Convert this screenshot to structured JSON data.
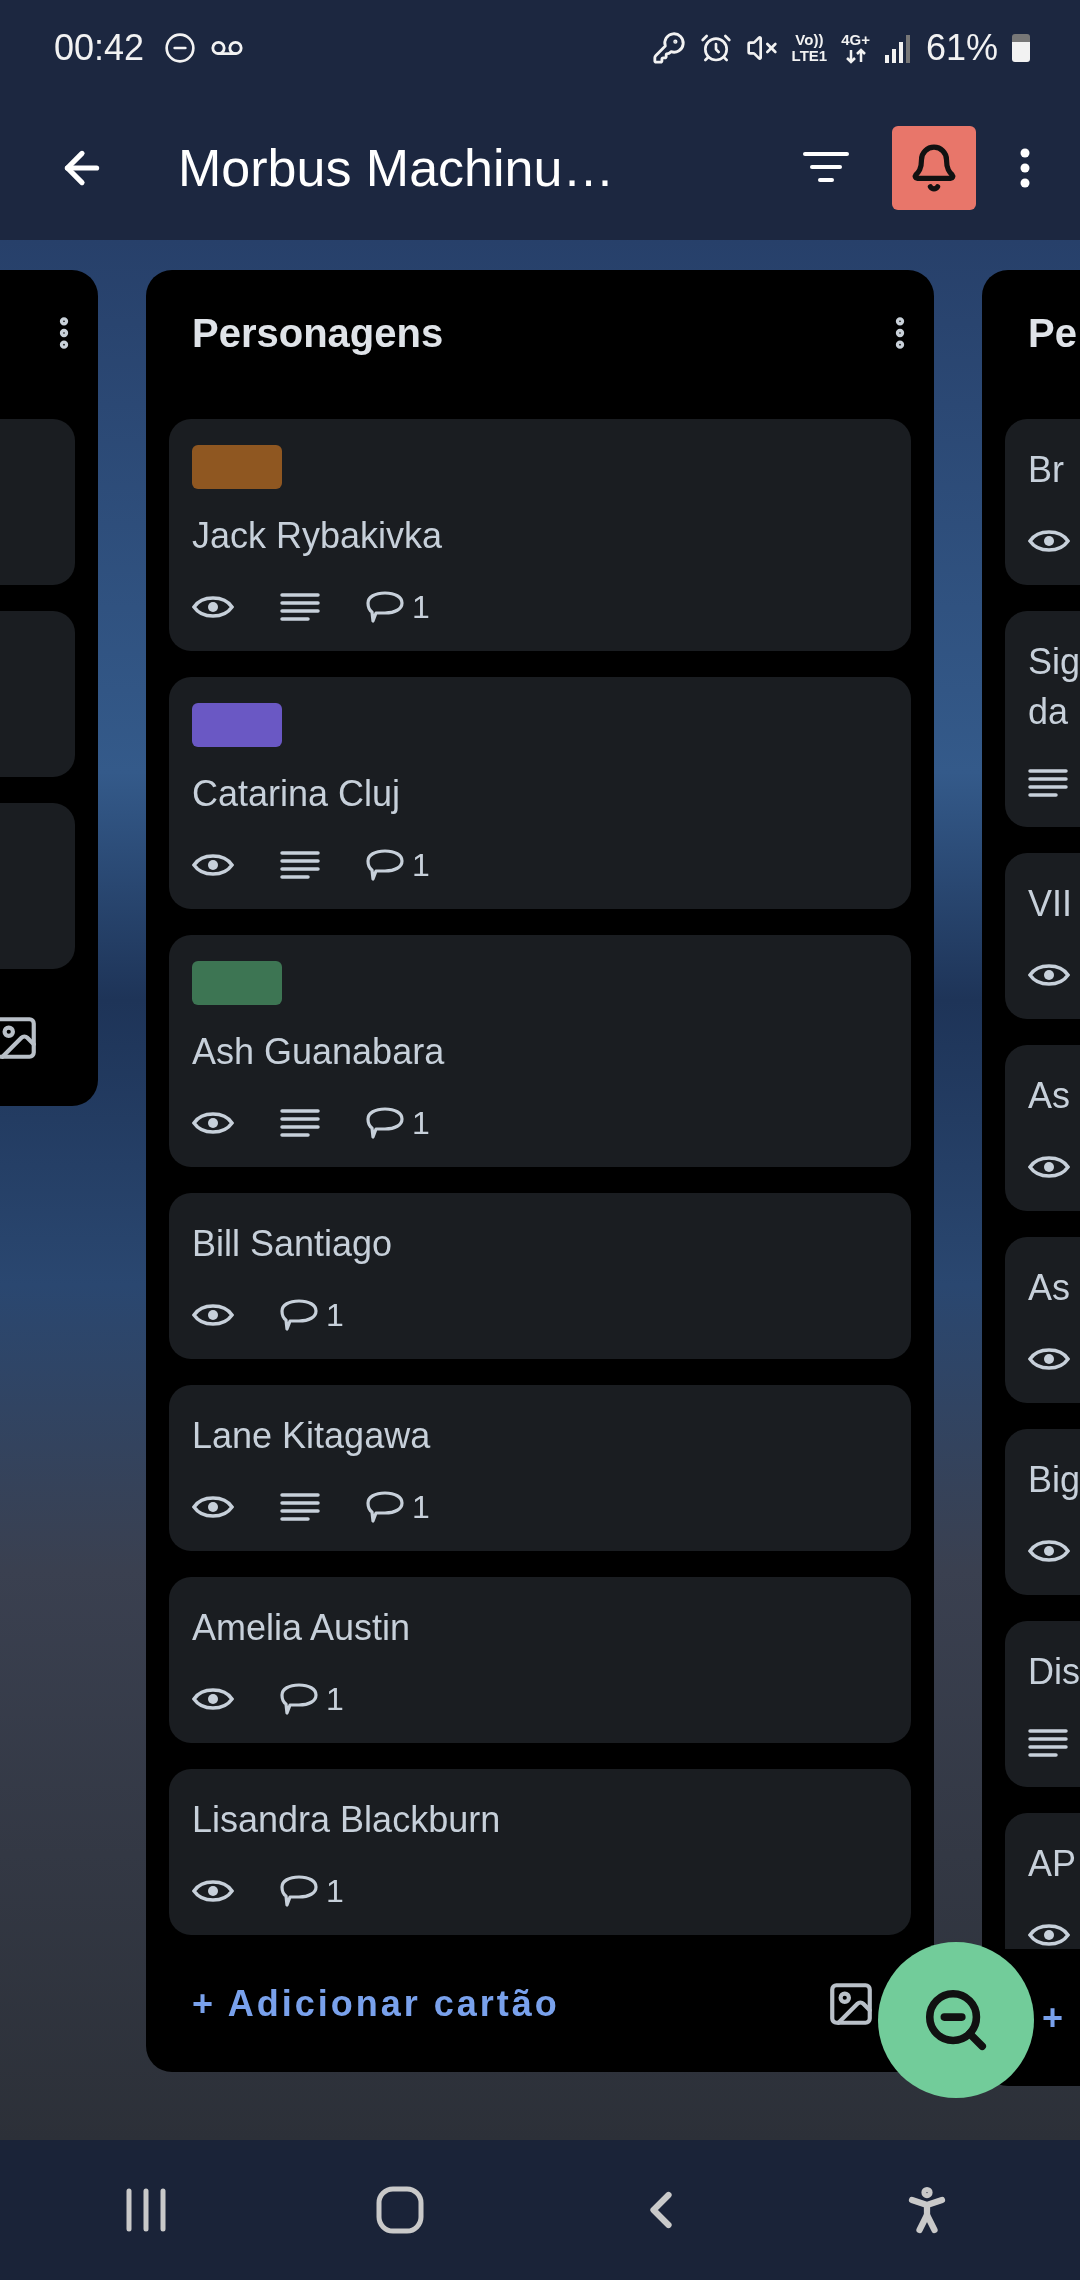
{
  "status_bar": {
    "time": "00:42",
    "volte_top": "Vo))",
    "volte_bottom": "LTE1",
    "network": "4G+",
    "battery": "61%"
  },
  "toolbar": {
    "title": "Morbus Machinu…",
    "notifications_on": true
  },
  "columns": [
    {
      "cards": [
        {
          "kind": "blank"
        },
        {
          "kind": "blank"
        },
        {
          "kind": "blank"
        }
      ]
    },
    {
      "title": "Personagens",
      "add_label": "+ Adicionar cartão",
      "cards": [
        {
          "color": "#8f5721",
          "title": "Jack Rybakivka",
          "watching": true,
          "description": true,
          "comments": "1"
        },
        {
          "color": "#6a58c4",
          "title": "Catarina Cluj",
          "watching": true,
          "description": true,
          "comments": "1"
        },
        {
          "color": "#3d7553",
          "title": "Ash Guanabara",
          "watching": true,
          "description": true,
          "comments": "1"
        },
        {
          "title": "Bill Santiago",
          "watching": true,
          "description": false,
          "comments": "1"
        },
        {
          "title": "Lane Kitagawa",
          "watching": true,
          "description": true,
          "comments": "1"
        },
        {
          "title": "Amelia Austin",
          "watching": true,
          "description": false,
          "comments": "1"
        },
        {
          "title": "Lisandra Blackburn",
          "watching": true,
          "description": false,
          "comments": "1"
        }
      ]
    },
    {
      "title": "Pe",
      "add_label": "+",
      "cards": [
        {
          "title": "Br",
          "watching": true,
          "description": false
        },
        {
          "title": "Sig da",
          "watching": false,
          "description": true
        },
        {
          "title": "VII",
          "watching": true,
          "description": false
        },
        {
          "title": "As",
          "watching": true,
          "description": false
        },
        {
          "title": "As",
          "watching": true,
          "description": false
        },
        {
          "title": "Big",
          "watching": true,
          "description": false
        },
        {
          "title": "Dis",
          "watching": false,
          "description": true
        },
        {
          "title": "AP",
          "watching": true,
          "description": false
        }
      ]
    }
  ]
}
